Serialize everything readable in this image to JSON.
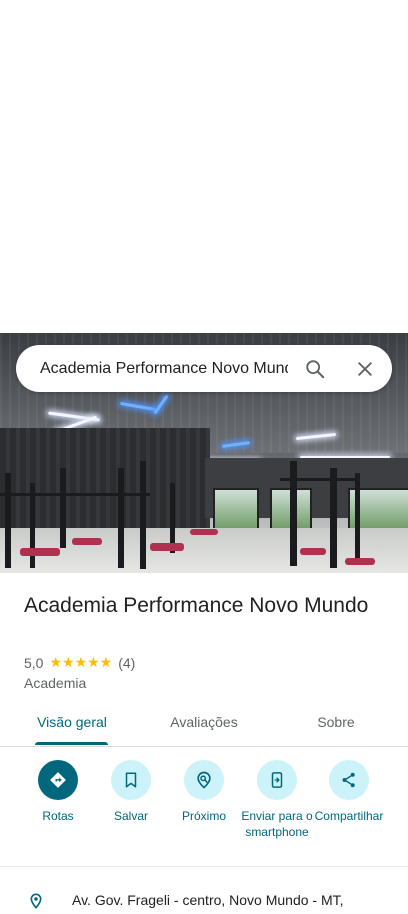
{
  "search": {
    "query": "Academia Performance Novo Mundo"
  },
  "place": {
    "name": "Academia Performance Novo Mundo",
    "rating": "5,0",
    "stars": "★★★★★",
    "review_count": "(4)",
    "category": "Academia",
    "address": "Av. Gov. Frageli - centro, Novo Mundo - MT,"
  },
  "tabs": [
    {
      "label": "Visão geral",
      "active": true
    },
    {
      "label": "Avaliações",
      "active": false
    },
    {
      "label": "Sobre",
      "active": false
    }
  ],
  "actions": [
    {
      "label": "Rotas",
      "icon": "directions-icon"
    },
    {
      "label": "Salvar",
      "icon": "bookmark-icon"
    },
    {
      "label": "Próximo",
      "icon": "nearby-icon"
    },
    {
      "label": "Enviar para o smartphone",
      "icon": "send-to-phone-icon"
    },
    {
      "label": "Compartilhar",
      "icon": "share-icon"
    }
  ],
  "colors": {
    "accent": "#00677d",
    "accent_light": "#cdf3fa",
    "star": "#fbbc04",
    "muted_text": "#5f6368"
  }
}
